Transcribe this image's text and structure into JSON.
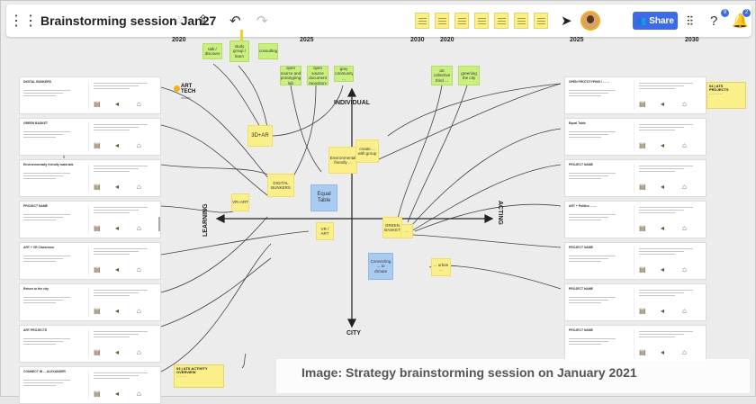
{
  "app": {
    "board_title": "Brainstorming session Jan27"
  },
  "toolbar": {
    "share_label": "Share",
    "help_badge": "9",
    "notif_badge": "2"
  },
  "icons": [
    "menu-icon",
    "star-icon",
    "upload-icon",
    "undo-icon",
    "redo-icon",
    "cursor-icon",
    "settings-icon",
    "help-icon",
    "notification-icon"
  ],
  "timeline": {
    "years_left": [
      "2020",
      "2025"
    ],
    "years_middle": [
      "2030",
      "2020"
    ],
    "years_right": [
      "2025",
      "2030"
    ]
  },
  "axes": {
    "top": "INDIVIDUAL",
    "bottom": "CITY",
    "left": "LEARNING",
    "right": "ACTING"
  },
  "logo": {
    "line1": "ART",
    "line2": "TECH",
    "sub": "SOCIETY"
  },
  "top_stickies": [
    "talk / discover",
    "study group / learn",
    "consulting"
  ],
  "green_stickies": [
    "open source and prototyping lab",
    "open source document repository",
    "grey community ...",
    "art collective third ...",
    "greening the city"
  ],
  "center_stickies": {
    "ar": "3D+AR",
    "digital_bunkers": "DIGITAL BUNKERS",
    "equal_table": "Equal Table",
    "green_basket": "GREEN BASKET",
    "vr": "VR+ART",
    "vr2": "VR / ART",
    "environment": "Environmental friendly ...",
    "collab": "create ... with group",
    "connecting": "Connecting ... to climate",
    "urban": "... urban ...",
    "small_a": "...",
    "small_b": "..."
  },
  "left_cards": [
    "DIGITAL BUNKERS",
    "GREEN BASKET",
    "Environmentally friendly materials",
    "PROJECT NAME",
    "ART + VR Classroom",
    "Return to the city",
    "ART PROJECTS",
    "CONNECT IN ... ALEXANDER"
  ],
  "right_cards": [
    "OPEN PROTOTYPING / ... ...",
    "Equal Table",
    "PROJECT NAME",
    "ART + Politics ... ...",
    "PROJECT NAME",
    "PROJECT NAME",
    "PROJECT NAME"
  ],
  "annotations": {
    "right": {
      "title": "04 | ATS PROJECTS",
      "body": "... ... ... ..."
    },
    "bottom": {
      "title": "03 | ATS ACTIVITY OVERVIEW",
      "body": "... ... ..."
    }
  },
  "caption": "Image: Strategy brainstorming session on January 2021",
  "colors": {
    "sticky_yellow": "#fbef8a",
    "sticky_green": "#c9ef7f",
    "sticky_blue": "#a9cbf1",
    "share_blue": "#3d6be5",
    "logo_yellow": "#f2b01e"
  }
}
